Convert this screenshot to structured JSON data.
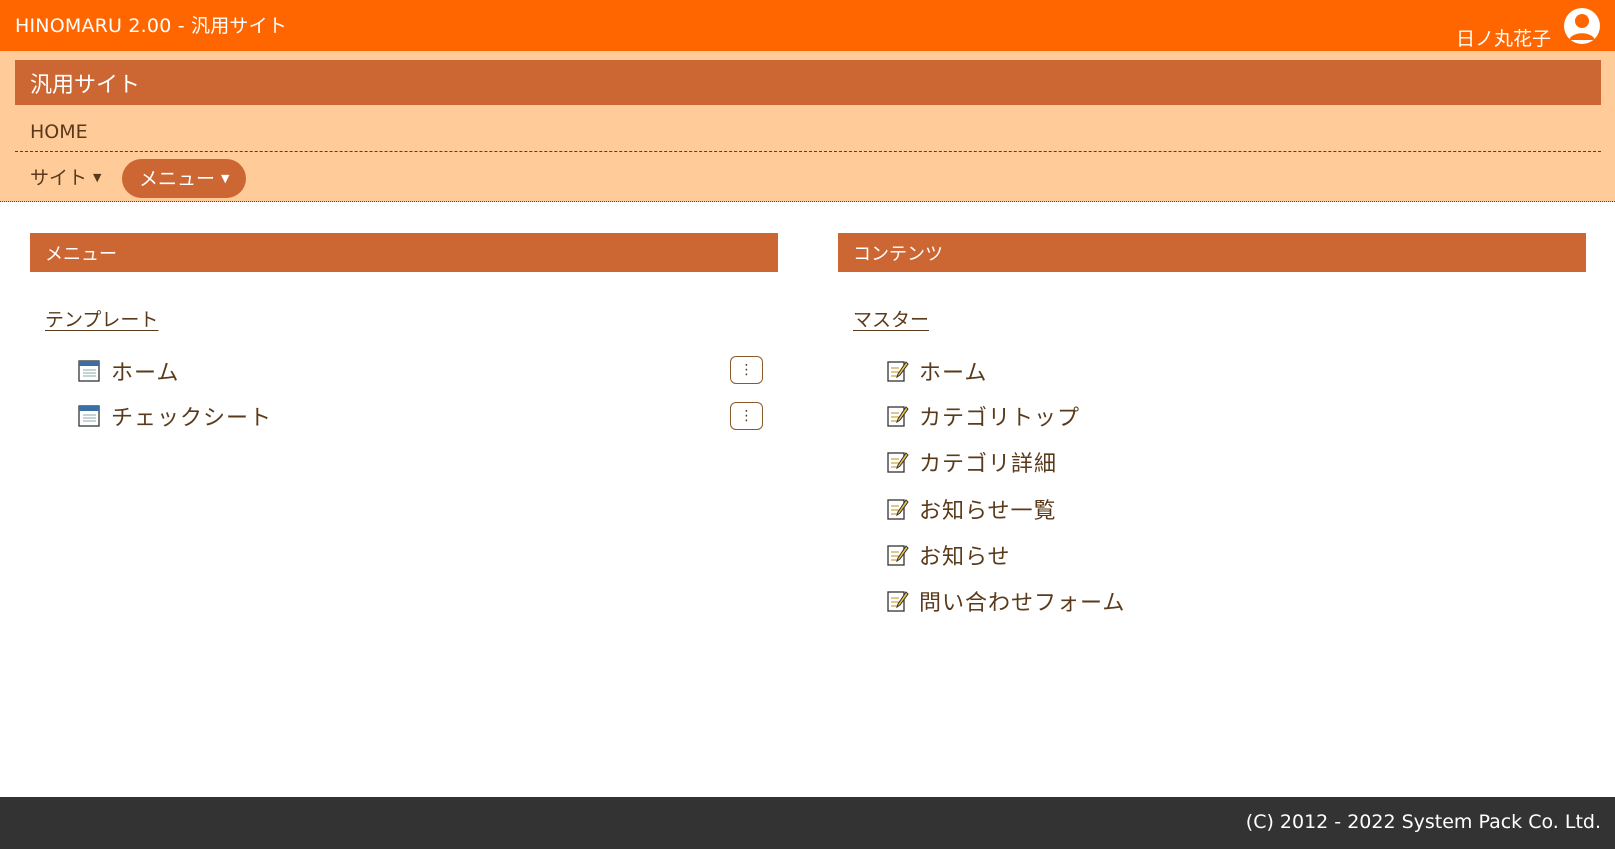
{
  "app": {
    "title": "HINOMARU 2.00 - 汎用サイト",
    "user_name": "日ノ丸花子",
    "accent": "#ff6600",
    "brand": "#cc6633",
    "band": "#ffcc99"
  },
  "site": {
    "title": "汎用サイト",
    "breadcrumb": "HOME",
    "site_menu": "サイト",
    "menu_button": "メニュー"
  },
  "left_panel": {
    "header": "メニュー",
    "group": "テンプレート",
    "items": [
      {
        "label": "ホーム",
        "icon": "template-icon",
        "action": "more-icon"
      },
      {
        "label": "チェックシート",
        "icon": "template-icon",
        "action": "more-icon"
      }
    ]
  },
  "right_panel": {
    "header": "コンテンツ",
    "group": "マスター",
    "items": [
      {
        "label": "ホーム",
        "icon": "edit-page-icon"
      },
      {
        "label": "カテゴリトップ",
        "icon": "edit-page-icon"
      },
      {
        "label": "カテゴリ詳細",
        "icon": "edit-page-icon"
      },
      {
        "label": "お知らせ一覧",
        "icon": "edit-page-icon"
      },
      {
        "label": "お知らせ",
        "icon": "edit-page-icon"
      },
      {
        "label": "問い合わせフォーム",
        "icon": "edit-page-icon"
      }
    ]
  },
  "footer": {
    "copyright": "(C) 2012 - 2022 System Pack Co. Ltd."
  }
}
